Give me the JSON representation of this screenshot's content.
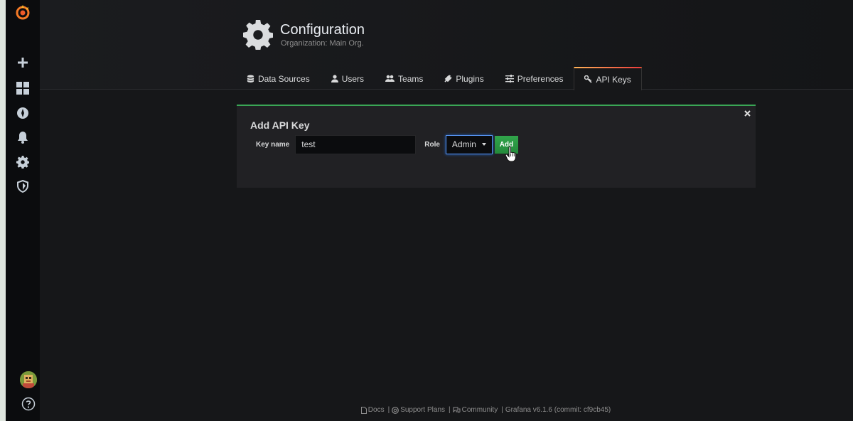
{
  "header": {
    "title": "Configuration",
    "subtitle": "Organization: Main Org."
  },
  "tabs": [
    {
      "label": "Data Sources",
      "icon": "database-icon"
    },
    {
      "label": "Users",
      "icon": "user-icon"
    },
    {
      "label": "Teams",
      "icon": "users-icon"
    },
    {
      "label": "Plugins",
      "icon": "plug-icon"
    },
    {
      "label": "Preferences",
      "icon": "sliders-icon"
    },
    {
      "label": "API Keys",
      "icon": "key-icon",
      "active": true
    }
  ],
  "panel": {
    "title": "Add API Key",
    "key_name_label": "Key name",
    "key_name_value": "test",
    "role_label": "Role",
    "role_value": "Admin",
    "add_label": "Add"
  },
  "footer": {
    "docs": "Docs",
    "support": "Support Plans",
    "community": "Community",
    "version": "Grafana v6.1.6 (commit: cf9cb45)"
  },
  "colors": {
    "accent_green": "#31a54b",
    "accent_orange": "#eb7b18",
    "focus_blue": "#5794f2"
  }
}
